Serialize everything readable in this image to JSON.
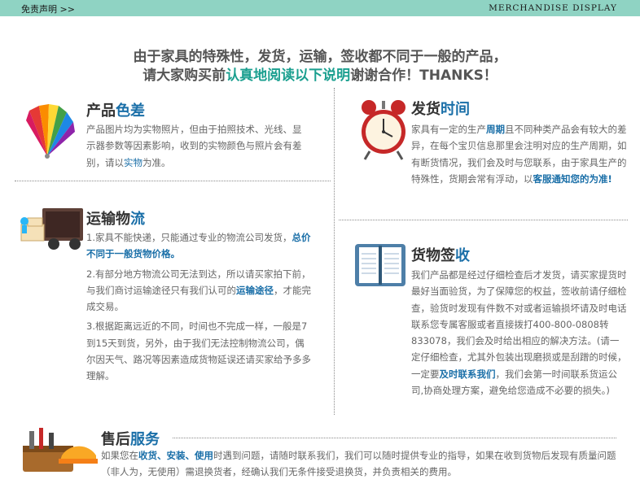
{
  "header": {
    "left": "免责声明 >>",
    "right": "MERCHANDISE DISPLAY"
  },
  "intro": {
    "line1": "由于家具的特殊性，发货，运输，签收都不同于一般的产品，",
    "line2_a": "请大家购买前",
    "line2_b": "认真地阅读以下说明",
    "line2_c": "谢谢合作！THANKS！"
  },
  "color_diff": {
    "title_a": "产品",
    "title_b": "色差",
    "text_a": "产品图片均为实物照片，但由于拍照技术、光线、显示器参数等因素影响，收到的实物颜色与照片会有差别，请以",
    "text_b": "实物",
    "text_c": "为准。"
  },
  "shipping": {
    "title_a": "发货",
    "title_b": "时间",
    "t1": "家具有一定的生产",
    "t2": "周期",
    "t3": "且不同种类产品会有较大的差异，在每个宝贝信息那里会注明对应的生产周期，如有断货情况，我们会及时与您联系，由于家具生产的特殊性，货期会常有浮动，以",
    "t4": "客服通知您的为准!"
  },
  "logistics": {
    "title_a": "运输物",
    "title_b": "流",
    "p1_a": "1.家具不能快递，只能通过专业的物流公司发货，",
    "p1_b": "总价不同于一般货物价格。",
    "p2_a": "2.有部分地方物流公司无法到达，所以请买家拍下前，与我们商讨运输途径只有我们认可的",
    "p2_b": "运输途径",
    "p2_c": "，才能完成交易。",
    "p3": "3.根据距离远近的不同，时间也不完成一样，一般是7到15天到货，另外，由于我们无法控制物流公司，偶尔因天气、路况等因素造成货物延误还请买家给予多多理解。"
  },
  "receipt": {
    "title_a": "货物签",
    "title_b": "收",
    "t1": "我们产品都是经过仔细检查后才发货，请买家提货时最好当面验货，为了保障您的权益，签收前请仔细检查，验货时发现有件数不对或者运输损坏请及时电话联系您专属客服或者直接拨打400-800-0808转833078，我们会及时给出相应的解决方法。(请一定仔细检查，尤其外包装出现磨损或是刮蹭的时候，一定要",
    "t2": "及时联系我们",
    "t3": "，我们会第一时间联系货运公司,协商处理方案，避免给您造成不必要的损失。)"
  },
  "after_sale": {
    "title_a": "售后",
    "title_b": "服务",
    "t1": "如果您在",
    "t2": "收货、安装、使用",
    "t3": "时遇到问题，请随时联系我们，我们可以随时提供专业的指导，如果在收到货物后发现有质量问题（非人为，无使用）需退换货者，经确认我们无条件接受退换货，并负责相关的费用。"
  },
  "icons": [
    "color-fan-icon",
    "alarm-clock-icon",
    "delivery-truck-icon",
    "notebook-icon",
    "tools-helmet-icon"
  ],
  "colors": {
    "header_bar": "#8fd3c3",
    "teal": "#1a9f8f",
    "blue": "#1a6fa8"
  }
}
